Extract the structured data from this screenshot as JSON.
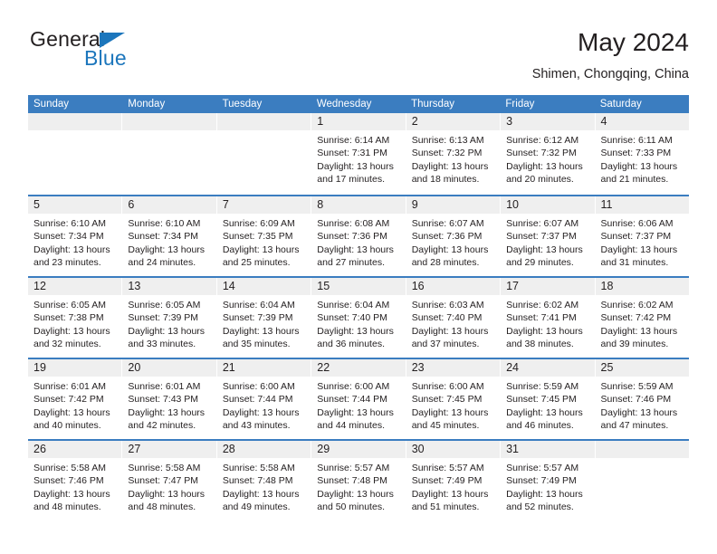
{
  "brand": {
    "name_top": "General",
    "name_bottom": "Blue",
    "triangle_icon": "triangle-icon",
    "accent_color": "#1c76bc"
  },
  "header": {
    "title": "May 2024",
    "subtitle": "Shimen, Chongqing, China"
  },
  "colors": {
    "header_blue": "#3b7dc0",
    "day_band_gray": "#efefef",
    "text": "#231f20"
  },
  "calendar": {
    "weekday_headers": [
      "Sunday",
      "Monday",
      "Tuesday",
      "Wednesday",
      "Thursday",
      "Friday",
      "Saturday"
    ],
    "weeks": [
      [
        {
          "day": "",
          "lines": []
        },
        {
          "day": "",
          "lines": []
        },
        {
          "day": "",
          "lines": []
        },
        {
          "day": "1",
          "lines": [
            "Sunrise: 6:14 AM",
            "Sunset: 7:31 PM",
            "Daylight: 13 hours",
            "and 17 minutes."
          ]
        },
        {
          "day": "2",
          "lines": [
            "Sunrise: 6:13 AM",
            "Sunset: 7:32 PM",
            "Daylight: 13 hours",
            "and 18 minutes."
          ]
        },
        {
          "day": "3",
          "lines": [
            "Sunrise: 6:12 AM",
            "Sunset: 7:32 PM",
            "Daylight: 13 hours",
            "and 20 minutes."
          ]
        },
        {
          "day": "4",
          "lines": [
            "Sunrise: 6:11 AM",
            "Sunset: 7:33 PM",
            "Daylight: 13 hours",
            "and 21 minutes."
          ]
        }
      ],
      [
        {
          "day": "5",
          "lines": [
            "Sunrise: 6:10 AM",
            "Sunset: 7:34 PM",
            "Daylight: 13 hours",
            "and 23 minutes."
          ]
        },
        {
          "day": "6",
          "lines": [
            "Sunrise: 6:10 AM",
            "Sunset: 7:34 PM",
            "Daylight: 13 hours",
            "and 24 minutes."
          ]
        },
        {
          "day": "7",
          "lines": [
            "Sunrise: 6:09 AM",
            "Sunset: 7:35 PM",
            "Daylight: 13 hours",
            "and 25 minutes."
          ]
        },
        {
          "day": "8",
          "lines": [
            "Sunrise: 6:08 AM",
            "Sunset: 7:36 PM",
            "Daylight: 13 hours",
            "and 27 minutes."
          ]
        },
        {
          "day": "9",
          "lines": [
            "Sunrise: 6:07 AM",
            "Sunset: 7:36 PM",
            "Daylight: 13 hours",
            "and 28 minutes."
          ]
        },
        {
          "day": "10",
          "lines": [
            "Sunrise: 6:07 AM",
            "Sunset: 7:37 PM",
            "Daylight: 13 hours",
            "and 29 minutes."
          ]
        },
        {
          "day": "11",
          "lines": [
            "Sunrise: 6:06 AM",
            "Sunset: 7:37 PM",
            "Daylight: 13 hours",
            "and 31 minutes."
          ]
        }
      ],
      [
        {
          "day": "12",
          "lines": [
            "Sunrise: 6:05 AM",
            "Sunset: 7:38 PM",
            "Daylight: 13 hours",
            "and 32 minutes."
          ]
        },
        {
          "day": "13",
          "lines": [
            "Sunrise: 6:05 AM",
            "Sunset: 7:39 PM",
            "Daylight: 13 hours",
            "and 33 minutes."
          ]
        },
        {
          "day": "14",
          "lines": [
            "Sunrise: 6:04 AM",
            "Sunset: 7:39 PM",
            "Daylight: 13 hours",
            "and 35 minutes."
          ]
        },
        {
          "day": "15",
          "lines": [
            "Sunrise: 6:04 AM",
            "Sunset: 7:40 PM",
            "Daylight: 13 hours",
            "and 36 minutes."
          ]
        },
        {
          "day": "16",
          "lines": [
            "Sunrise: 6:03 AM",
            "Sunset: 7:40 PM",
            "Daylight: 13 hours",
            "and 37 minutes."
          ]
        },
        {
          "day": "17",
          "lines": [
            "Sunrise: 6:02 AM",
            "Sunset: 7:41 PM",
            "Daylight: 13 hours",
            "and 38 minutes."
          ]
        },
        {
          "day": "18",
          "lines": [
            "Sunrise: 6:02 AM",
            "Sunset: 7:42 PM",
            "Daylight: 13 hours",
            "and 39 minutes."
          ]
        }
      ],
      [
        {
          "day": "19",
          "lines": [
            "Sunrise: 6:01 AM",
            "Sunset: 7:42 PM",
            "Daylight: 13 hours",
            "and 40 minutes."
          ]
        },
        {
          "day": "20",
          "lines": [
            "Sunrise: 6:01 AM",
            "Sunset: 7:43 PM",
            "Daylight: 13 hours",
            "and 42 minutes."
          ]
        },
        {
          "day": "21",
          "lines": [
            "Sunrise: 6:00 AM",
            "Sunset: 7:44 PM",
            "Daylight: 13 hours",
            "and 43 minutes."
          ]
        },
        {
          "day": "22",
          "lines": [
            "Sunrise: 6:00 AM",
            "Sunset: 7:44 PM",
            "Daylight: 13 hours",
            "and 44 minutes."
          ]
        },
        {
          "day": "23",
          "lines": [
            "Sunrise: 6:00 AM",
            "Sunset: 7:45 PM",
            "Daylight: 13 hours",
            "and 45 minutes."
          ]
        },
        {
          "day": "24",
          "lines": [
            "Sunrise: 5:59 AM",
            "Sunset: 7:45 PM",
            "Daylight: 13 hours",
            "and 46 minutes."
          ]
        },
        {
          "day": "25",
          "lines": [
            "Sunrise: 5:59 AM",
            "Sunset: 7:46 PM",
            "Daylight: 13 hours",
            "and 47 minutes."
          ]
        }
      ],
      [
        {
          "day": "26",
          "lines": [
            "Sunrise: 5:58 AM",
            "Sunset: 7:46 PM",
            "Daylight: 13 hours",
            "and 48 minutes."
          ]
        },
        {
          "day": "27",
          "lines": [
            "Sunrise: 5:58 AM",
            "Sunset: 7:47 PM",
            "Daylight: 13 hours",
            "and 48 minutes."
          ]
        },
        {
          "day": "28",
          "lines": [
            "Sunrise: 5:58 AM",
            "Sunset: 7:48 PM",
            "Daylight: 13 hours",
            "and 49 minutes."
          ]
        },
        {
          "day": "29",
          "lines": [
            "Sunrise: 5:57 AM",
            "Sunset: 7:48 PM",
            "Daylight: 13 hours",
            "and 50 minutes."
          ]
        },
        {
          "day": "30",
          "lines": [
            "Sunrise: 5:57 AM",
            "Sunset: 7:49 PM",
            "Daylight: 13 hours",
            "and 51 minutes."
          ]
        },
        {
          "day": "31",
          "lines": [
            "Sunrise: 5:57 AM",
            "Sunset: 7:49 PM",
            "Daylight: 13 hours",
            "and 52 minutes."
          ]
        },
        {
          "day": "",
          "lines": []
        }
      ]
    ]
  }
}
